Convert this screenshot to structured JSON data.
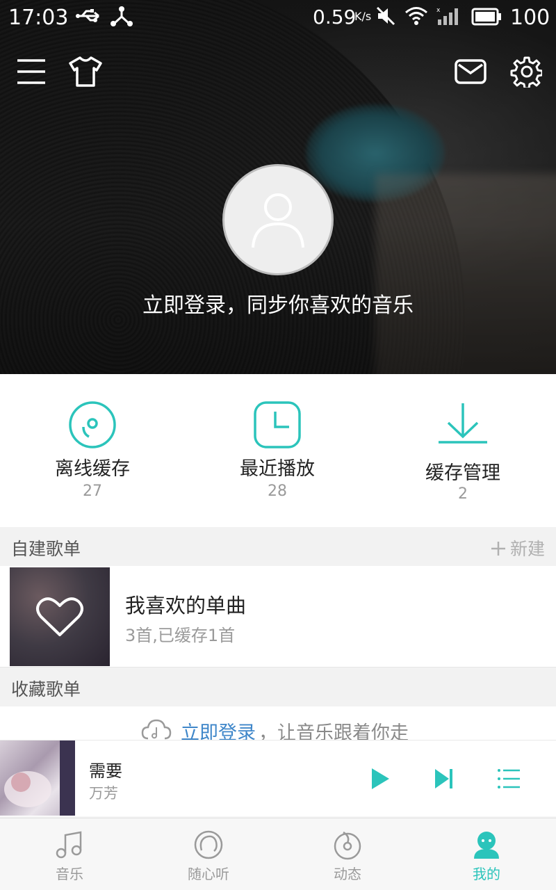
{
  "status_bar": {
    "time": "17:03",
    "speed": "0.59",
    "speed_unit": "K/s",
    "battery": "100"
  },
  "header": {
    "menu_icon": "menu-icon",
    "skin_icon": "tshirt-icon",
    "mail_icon": "mail-icon",
    "settings_icon": "gear-icon"
  },
  "profile": {
    "login_prompt": "立即登录，同步你喜欢的音乐"
  },
  "quick_access": [
    {
      "label": "离线缓存",
      "count": "27",
      "icon": "disc-icon"
    },
    {
      "label": "最近播放",
      "count": "28",
      "icon": "clock-icon"
    },
    {
      "label": "缓存管理",
      "count": "2",
      "icon": "download-icon"
    }
  ],
  "my_playlists": {
    "title": "自建歌单",
    "new_label": "新建",
    "items": [
      {
        "name": "我喜欢的单曲",
        "meta": "3首,已缓存1首"
      }
    ]
  },
  "favorite_playlists": {
    "title": "收藏歌单",
    "login_link": "立即登录",
    "login_rest": "，让音乐跟着你走"
  },
  "now_playing": {
    "song": "需要",
    "artist": "万芳"
  },
  "tabs": [
    {
      "label": "音乐",
      "icon": "music-note-icon"
    },
    {
      "label": "随心听",
      "icon": "radio-icon"
    },
    {
      "label": "动态",
      "icon": "feed-icon"
    },
    {
      "label": "我的",
      "icon": "user-icon",
      "active": true
    }
  ],
  "colors": {
    "accent": "#2bc4bb",
    "link": "#3e86c9"
  }
}
